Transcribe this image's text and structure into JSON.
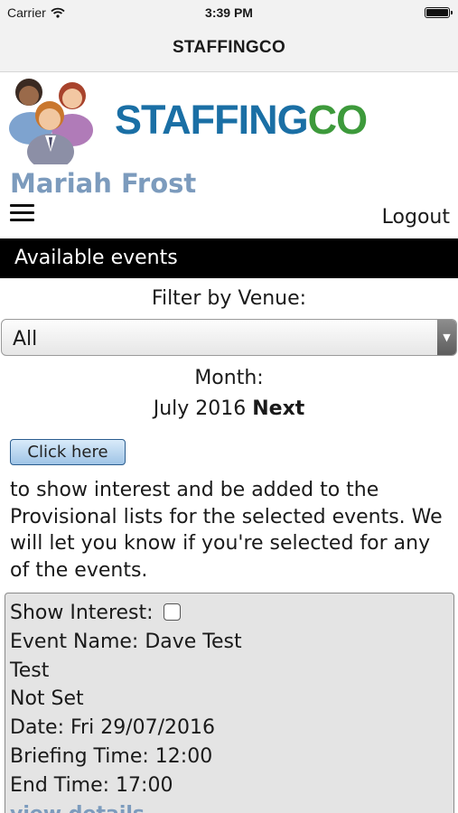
{
  "status_bar": {
    "carrier": "Carrier",
    "time": "3:39 PM",
    "icons": [
      "wifi-icon",
      "battery-icon"
    ]
  },
  "nav": {
    "title": "STAFFINGCO"
  },
  "logo": {
    "word_a": "STAFFING",
    "word_b": "CO",
    "colors": {
      "blue": "#1a6fa5",
      "green": "#3d9a3b"
    }
  },
  "user": {
    "name": "Mariah Frost"
  },
  "menu": {
    "icon": "hamburger-menu-icon",
    "logout_label": "Logout"
  },
  "section": {
    "title": "Available events"
  },
  "filter": {
    "label": "Filter by Venue:",
    "selected": "All"
  },
  "month": {
    "label": "Month:",
    "current": "July 2016",
    "next_label": "Next"
  },
  "interest": {
    "button_label": "Click here",
    "description": "to show interest and be added to the Provisional lists for the selected events. We will let you know if you're selected for any of the events."
  },
  "event": {
    "show_interest_label": "Show Interest:",
    "show_interest_checked": false,
    "name_line": "Event Name: Dave Test",
    "line2": "Test",
    "line3": "Not Set",
    "date_line": "Date: Fri 29/07/2016",
    "briefing_line": "Briefing Time: 12:00",
    "end_line": "End Time: 17:00",
    "details_link": "view details"
  },
  "colors": {
    "accent": "#7c9bbd",
    "header_bar": "#000000",
    "card_bg": "#e4e4e4"
  }
}
